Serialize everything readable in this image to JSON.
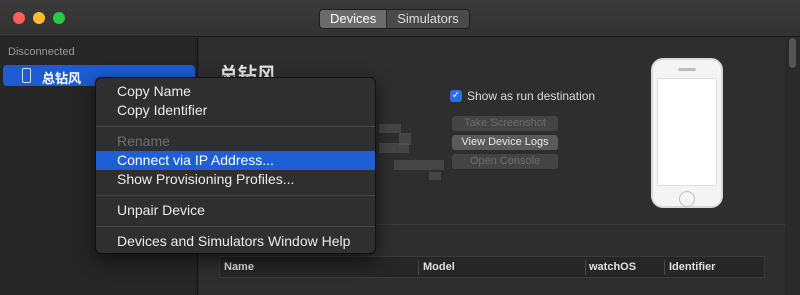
{
  "titlebar": {
    "tabs": [
      {
        "label": "Devices",
        "active": true
      },
      {
        "label": "Simulators",
        "active": false
      }
    ]
  },
  "sidebar": {
    "section_header": "Disconnected",
    "items": [
      {
        "label": "总钻风",
        "icon": "iphone-icon",
        "selected": true
      }
    ]
  },
  "main": {
    "device_name": "总钻风",
    "run_destination_label": "Show as run destination",
    "run_destination_checked": true,
    "buttons": {
      "screenshot": "Take Screenshot",
      "device_logs": "View Device Logs",
      "console": "Open Console"
    },
    "table_columns": [
      "Name",
      "Model",
      "watchOS",
      "Identifier"
    ]
  },
  "context_menu": {
    "items": [
      {
        "label": "Copy Name",
        "enabled": true
      },
      {
        "label": "Copy Identifier",
        "enabled": true
      },
      {
        "label": "Rename",
        "enabled": false
      },
      {
        "label": "Connect via IP Address...",
        "enabled": true,
        "highlighted": true
      },
      {
        "label": "Show Provisioning Profiles...",
        "enabled": true
      },
      {
        "label": "Unpair Device",
        "enabled": true
      },
      {
        "label": "Devices and Simulators Window Help",
        "enabled": true
      }
    ]
  },
  "colors": {
    "accent": "#1f5fd6",
    "window_bg": "#2b2b2b",
    "menu_bg": "#2f2f2f"
  }
}
